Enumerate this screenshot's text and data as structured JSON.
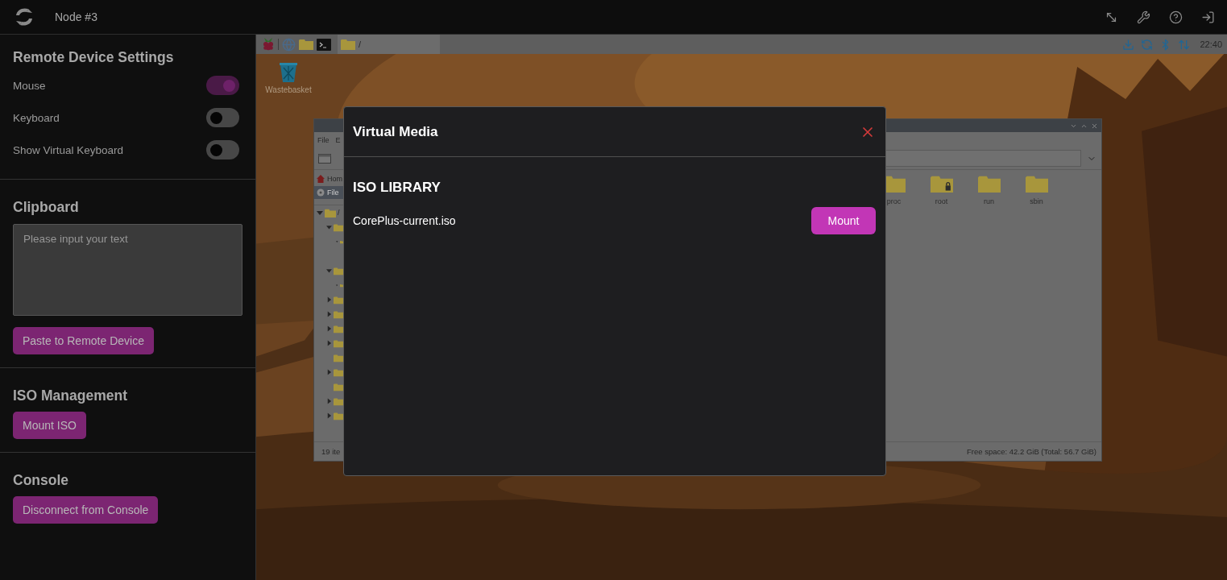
{
  "header": {
    "title": "Node #3",
    "actions": [
      {
        "kind": "fullscreen"
      },
      {
        "kind": "settings"
      },
      {
        "kind": "help"
      },
      {
        "kind": "logout"
      }
    ]
  },
  "sidebar": {
    "sections": [
      {
        "title": "Remote Device Settings",
        "toggles": [
          {
            "label": "Mouse",
            "on": true
          },
          {
            "label": "Keyboard",
            "on": false
          },
          {
            "label": "Show Virtual Keyboard",
            "on": false
          }
        ]
      },
      {
        "title": "Clipboard",
        "field": {
          "placeholder": "Please input your text"
        },
        "buttons": [
          "Paste to Remote Device"
        ]
      },
      {
        "title": "ISO Management",
        "buttons": [
          "Mount ISO"
        ]
      },
      {
        "title": "Console",
        "buttons": [
          "Disconnect from Console"
        ]
      }
    ]
  },
  "remote_screen": {
    "taskbar": {
      "launchers": [
        {
          "kind": "raspberry"
        },
        {
          "kind": "globe"
        },
        {
          "kind": "folder"
        },
        {
          "kind": "terminal"
        }
      ],
      "task": {
        "label": "/"
      },
      "tray": [
        {
          "kind": "download"
        },
        {
          "kind": "sync"
        },
        {
          "kind": "bluetooth"
        },
        {
          "kind": "network"
        }
      ],
      "clock": "22:40"
    },
    "desktop_icons": [
      {
        "label": "Wastebasket"
      }
    ],
    "file_manager": {
      "menu": [
        "File",
        "E"
      ],
      "places": [
        {
          "kind": "home",
          "label": "Hom",
          "selected": false
        },
        {
          "kind": "drive",
          "label": "File",
          "selected": true
        }
      ],
      "tree": [
        {
          "label": "/",
          "has_children": true,
          "expanded": true,
          "children": [
            {
              "has_children": true,
              "expanded": true,
              "children": [
                {
                  "has_children": true,
                  "expanded": true
                }
              ]
            },
            {
              "has_children": true,
              "expanded": true,
              "children": [
                {
                  "has_children": true,
                  "expanded": false
                }
              ]
            },
            {
              "has_children": true,
              "expanded": false
            },
            {
              "has_children": true,
              "expanded": false
            },
            {
              "has_children": true,
              "expanded": false
            },
            {
              "has_children": true,
              "expanded": false
            },
            {
              "has_children": false,
              "expanded": false
            },
            {
              "has_children": true,
              "expanded": false
            },
            {
              "has_children": false,
              "expanded": false
            },
            {
              "has_children": true,
              "expanded": false
            },
            {
              "has_children": true,
              "expanded": false
            }
          ]
        }
      ],
      "folders": [
        {
          "label": "proc",
          "locked": false
        },
        {
          "label": "root",
          "locked": true
        },
        {
          "label": "run",
          "locked": false
        },
        {
          "label": "sbin",
          "locked": false
        }
      ],
      "status": "19 ite",
      "free_space": "Free space: 42.2 GiB (Total: 56.7 GiB)"
    }
  },
  "dialog": {
    "title": "Virtual Media",
    "section": "ISO LIBRARY",
    "items": [
      {
        "name": "CorePlus-current.iso",
        "action": "Mount"
      }
    ]
  }
}
